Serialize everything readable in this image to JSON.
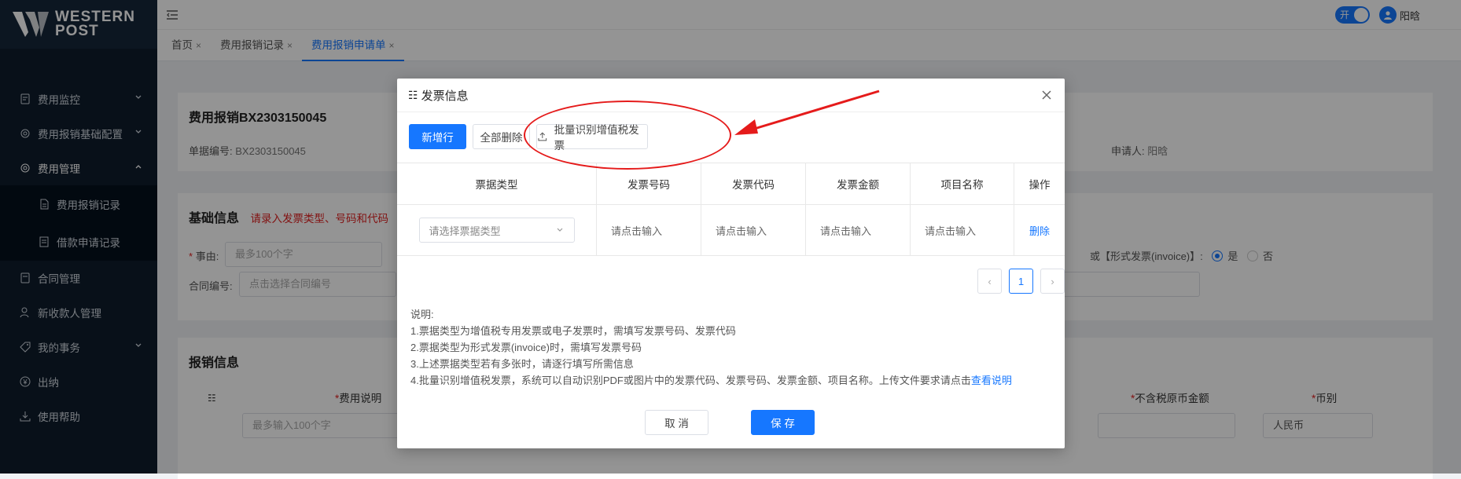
{
  "logo": {
    "line1": "WESTERN",
    "line2": "POST"
  },
  "sidebar": {
    "items": [
      {
        "label": "费用监控",
        "icon": "document-icon",
        "chevron": "down"
      },
      {
        "label": "费用报销基础配置",
        "icon": "gear-icon",
        "chevron": "down"
      },
      {
        "label": "费用管理",
        "icon": "gear-icon",
        "chevron": "up"
      }
    ],
    "subitems": [
      {
        "label": "费用报销记录",
        "icon": "file-icon"
      },
      {
        "label": "借款申请记录",
        "icon": "list-icon"
      }
    ],
    "items_after": [
      {
        "label": "合同管理",
        "icon": "document-icon",
        "chevron": ""
      },
      {
        "label": "新收款人管理",
        "icon": "user-icon",
        "chevron": ""
      },
      {
        "label": "我的事务",
        "icon": "tag-icon",
        "chevron": "down"
      },
      {
        "label": "出纳",
        "icon": "yen-icon",
        "chevron": ""
      },
      {
        "label": "使用帮助",
        "icon": "download-icon",
        "chevron": ""
      }
    ]
  },
  "header": {
    "toggle_label": "开",
    "user_name": "阳晗"
  },
  "tabs": [
    {
      "label": "首页",
      "active": false
    },
    {
      "label": "费用报销记录",
      "active": false
    },
    {
      "label": "费用报销申请单",
      "active": true
    }
  ],
  "tab_close": "×",
  "background": {
    "title": "费用报销BX2303150045",
    "doc_no_label": "单据编号:",
    "doc_no_value": "BX2303150045",
    "applicant_label": "申请人:",
    "applicant_value": "阳晗",
    "basic_title": "基础信息",
    "basic_hint": "请录入发票类型、号码和代码",
    "reason_label": "事由:",
    "reason_placeholder": "最多100个字",
    "contract_label": "合同编号:",
    "contract_placeholder": "点击选择合同编号",
    "invoice_question": "或【形式发票(invoice)】:",
    "yes": "是",
    "no": "否",
    "reimb_title": "报销信息",
    "col_desc": "费用说明",
    "col_amount": "不含税原币金额",
    "col_currency": "币别",
    "desc_placeholder": "最多输入100个字",
    "currency_value": "人民币"
  },
  "modal": {
    "title": "发票信息",
    "title_icon": "☷",
    "add_row": "新增行",
    "delete_all": "全部删除",
    "batch_recognize": "批量识别增值税发票",
    "columns": [
      "票据类型",
      "发票号码",
      "发票代码",
      "发票金额",
      "项目名称",
      "操作"
    ],
    "row": {
      "type_placeholder": "请选择票据类型",
      "invoice_no": "请点击输入",
      "invoice_code": "请点击输入",
      "amount": "请点击输入",
      "project": "请点击输入",
      "action": "删除"
    },
    "pager": {
      "prev": "‹",
      "page": "1",
      "next": "›"
    },
    "notes_title": "说明:",
    "notes": [
      "1.票据类型为增值税专用发票或电子发票时，需填写发票号码、发票代码",
      "2.票据类型为形式发票(invoice)时，需填写发票号码",
      "3.上述票据类型若有多张时，请逐行填写所需信息"
    ],
    "note4_text": "4.批量识别增值税发票，系统可以自动识别PDF或图片中的发票代码、发票号码、发票金额、项目名称。上传文件要求请点击",
    "note4_link": "查看说明",
    "cancel": "取 消",
    "save": "保 存"
  },
  "colors": {
    "primary": "#1677ff",
    "annotation": "#e51b1b",
    "sidebar_bg": "#0e1c2b"
  }
}
